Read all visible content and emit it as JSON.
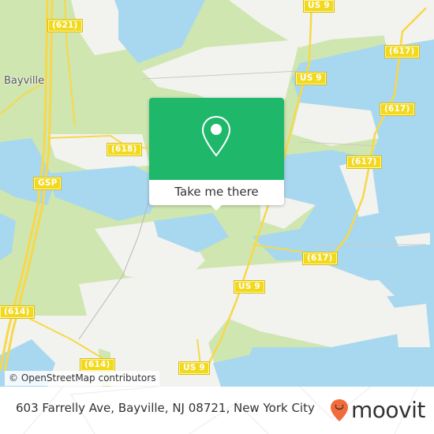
{
  "map": {
    "place_labels": [
      {
        "name": "Bayville"
      }
    ],
    "road_shields": [
      {
        "label": "(621)"
      },
      {
        "label": "US 9"
      },
      {
        "label": "(617)"
      },
      {
        "label": "US 9"
      },
      {
        "label": "(617)"
      },
      {
        "label": "(618)"
      },
      {
        "label": "GSP"
      },
      {
        "label": "(617)"
      },
      {
        "label": "(617)"
      },
      {
        "label": "US 9"
      },
      {
        "label": "(614)"
      },
      {
        "label": "(614)"
      },
      {
        "label": "US 9"
      }
    ],
    "colors": {
      "water": "#a8d8ef",
      "land": "#f2f2ef",
      "park": "#cfe6b0",
      "road": "#f7d84a"
    },
    "attribution": "© OpenStreetMap contributors"
  },
  "popup": {
    "icon": "map-pin-icon",
    "button_label": "Take me there",
    "accent_color": "#1fb86a"
  },
  "footer": {
    "address": "603 Farrelly Ave, Bayville, NJ 08721, New York City",
    "brand": "moovit",
    "brand_icon": "moovit-pin-smile-icon",
    "brand_color": "#f26b3a"
  }
}
